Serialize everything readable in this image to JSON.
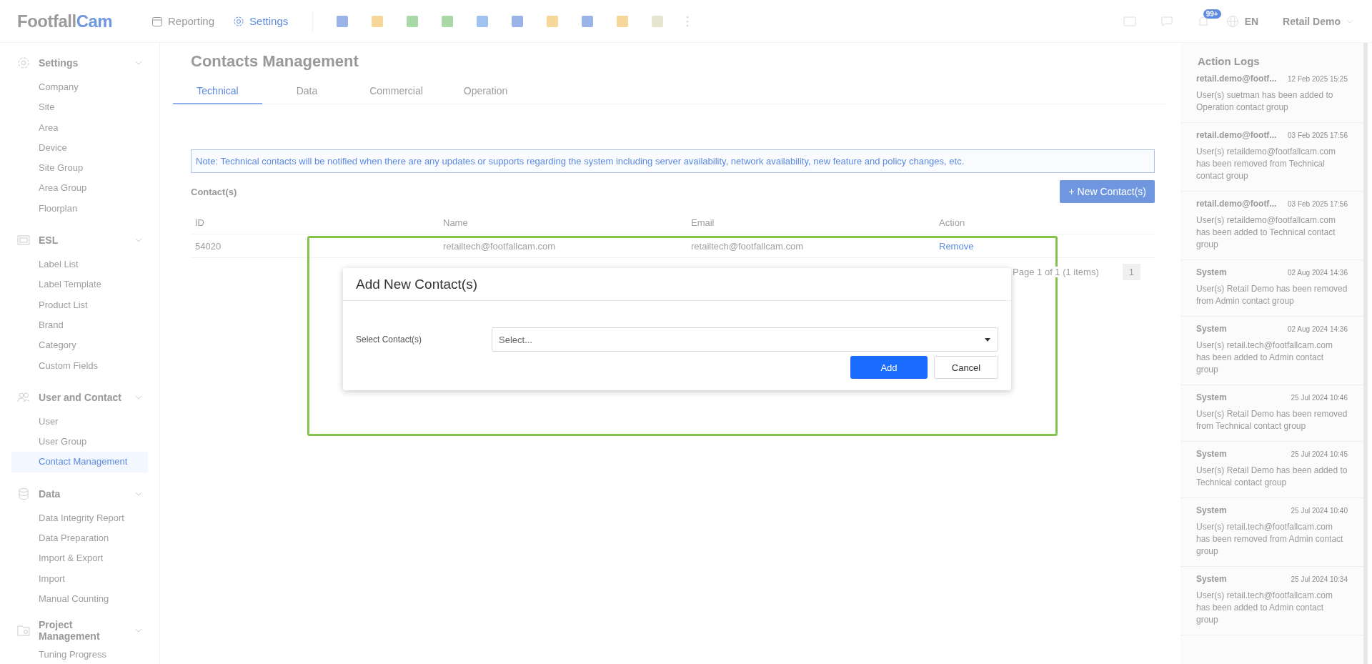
{
  "logo": {
    "text": "Footfall",
    "accent": "Cam"
  },
  "nav": [
    {
      "label": "Reporting",
      "selected": false
    },
    {
      "label": "Settings",
      "selected": true
    }
  ],
  "header": {
    "badge": "99+",
    "language": "EN",
    "user": "Retail Demo"
  },
  "sidebar": {
    "groups": [
      {
        "label": "Settings",
        "expanded": true,
        "items": [
          {
            "label": "Company",
            "selected": false
          },
          {
            "label": "Site",
            "selected": false
          },
          {
            "label": "Area",
            "selected": false
          },
          {
            "label": "Device",
            "selected": false
          },
          {
            "label": "Site Group",
            "selected": false
          },
          {
            "label": "Area Group",
            "selected": false
          },
          {
            "label": "Floorplan",
            "selected": false
          }
        ]
      },
      {
        "label": "ESL",
        "expanded": true,
        "items": [
          {
            "label": "Label List",
            "selected": false
          },
          {
            "label": "Label Template",
            "selected": false
          },
          {
            "label": "Product List",
            "selected": false
          },
          {
            "label": "Brand",
            "selected": false
          },
          {
            "label": "Category",
            "selected": false
          },
          {
            "label": "Custom Fields",
            "selected": false
          }
        ]
      },
      {
        "label": "User and Contact",
        "expanded": true,
        "items": [
          {
            "label": "User",
            "selected": false
          },
          {
            "label": "User Group",
            "selected": false
          },
          {
            "label": "Contact Management",
            "selected": true
          }
        ]
      },
      {
        "label": "Data",
        "expanded": true,
        "items": [
          {
            "label": "Data Integrity Report",
            "selected": false
          },
          {
            "label": "Data Preparation",
            "selected": false
          },
          {
            "label": "Import & Export",
            "selected": false
          },
          {
            "label": "Import",
            "selected": false
          },
          {
            "label": "Manual Counting",
            "selected": false
          }
        ]
      },
      {
        "label": "Project Management",
        "expanded": true,
        "items": [
          {
            "label": "Tuning Progress",
            "selected": false
          }
        ]
      }
    ]
  },
  "page": {
    "title": "Contacts Management",
    "tabs": [
      {
        "label": "Technical",
        "selected": true
      },
      {
        "label": "Data",
        "selected": false
      },
      {
        "label": "Commercial",
        "selected": false
      },
      {
        "label": "Operation",
        "selected": false
      }
    ],
    "note": "Note: Technical contacts will be notified when there are any updates or supports regarding the system including server availability, network availability, new feature and policy changes, etc.",
    "section_label": "Contact(s)",
    "new_button": "+ New Contact(s)",
    "table": {
      "columns": [
        "ID",
        "Name",
        "Email",
        "Action"
      ],
      "rows": [
        {
          "id": "54020",
          "name": "retailtech@footfallcam.com",
          "email": "retailtech@footfallcam.com",
          "action": "Remove"
        }
      ]
    },
    "pagination": {
      "summary": "Page 1 of 1 (1 items)",
      "pages": [
        "1"
      ]
    }
  },
  "dialog": {
    "title": "Add New Contact(s)",
    "field_label": "Select Contact(s)",
    "placeholder": "Select...",
    "buttons": [
      {
        "label": "Add",
        "kind": "primary"
      },
      {
        "label": "Cancel",
        "kind": "secondary"
      }
    ]
  },
  "action_logs": {
    "title": "Action Logs",
    "entries": [
      {
        "user": "retail.demo@footf...",
        "time": "12 Feb 2025 15:25",
        "message": "User(s) suetman has been added to Operation contact group"
      },
      {
        "user": "retail.demo@footf...",
        "time": "03 Feb 2025 17:56",
        "message": "User(s) retaildemo@footfallcam.com has been removed from Technical contact group"
      },
      {
        "user": "retail.demo@footf...",
        "time": "03 Feb 2025 17:56",
        "message": "User(s) retaildemo@footfallcam.com has been added to Technical contact group"
      },
      {
        "user": "System",
        "time": "02 Aug 2024 14:36",
        "message": "User(s) Retail Demo has been removed from Admin contact group"
      },
      {
        "user": "System",
        "time": "02 Aug 2024 14:36",
        "message": "User(s) retail.tech@footfallcam.com has been added to Admin contact group"
      },
      {
        "user": "System",
        "time": "25 Jul 2024 10:46",
        "message": "User(s) Retail Demo has been removed from Technical contact group"
      },
      {
        "user": "System",
        "time": "25 Jul 2024 10:45",
        "message": "User(s) Retail Demo has been added to Technical contact group"
      },
      {
        "user": "System",
        "time": "25 Jul 2024 10:40",
        "message": "User(s) retail.tech@footfallcam.com has been removed from Admin contact group"
      },
      {
        "user": "System",
        "time": "25 Jul 2024 10:34",
        "message": "User(s) retail.tech@footfallcam.com has been added to Admin contact group"
      }
    ]
  }
}
